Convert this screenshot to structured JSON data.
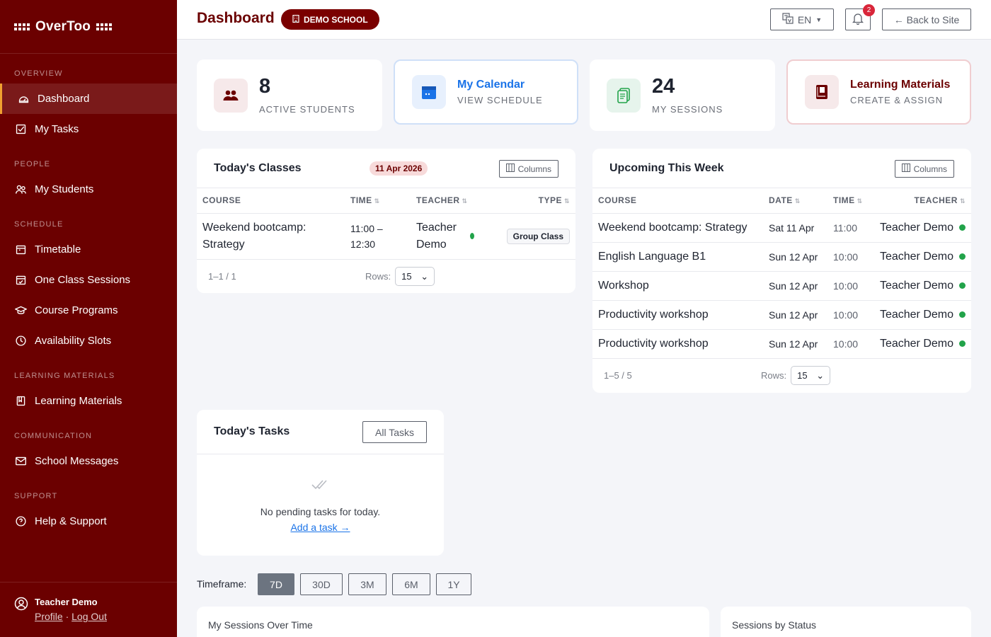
{
  "brand": {
    "name": "OverToo"
  },
  "sidebar": {
    "sections": [
      {
        "label": "OVERVIEW"
      },
      {
        "label": "PEOPLE"
      },
      {
        "label": "SCHEDULE"
      },
      {
        "label": "LEARNING MATERIALS"
      },
      {
        "label": "COMMUNICATION"
      },
      {
        "label": "SUPPORT"
      }
    ],
    "items": [
      {
        "label": "Dashboard",
        "icon": "dashboard-icon",
        "active": true
      },
      {
        "label": "My Tasks",
        "icon": "tasks-icon"
      },
      {
        "label": "My Students",
        "icon": "students-icon"
      },
      {
        "label": "Timetable",
        "icon": "timetable-icon"
      },
      {
        "label": "One Class Sessions",
        "icon": "calendar-check-icon"
      },
      {
        "label": "Course Programs",
        "icon": "graduation-cap-icon"
      },
      {
        "label": "Availability Slots",
        "icon": "clock-icon"
      },
      {
        "label": "Learning Materials",
        "icon": "book-icon"
      },
      {
        "label": "School Messages",
        "icon": "mail-icon"
      },
      {
        "label": "Help & Support",
        "icon": "help-icon"
      }
    ],
    "user": {
      "name": "Teacher Demo",
      "profile_label": "Profile",
      "logout_label": "Log Out"
    }
  },
  "topbar": {
    "title": "Dashboard",
    "school_badge": "DEMO SCHOOL",
    "language": "EN",
    "notification_count": "2",
    "back_label": "← Back to Site"
  },
  "stats": [
    {
      "value": "8",
      "label": "ACTIVE STUDENTS"
    },
    {
      "title": "My Calendar",
      "label": "VIEW SCHEDULE"
    },
    {
      "value": "24",
      "label": "MY SESSIONS"
    },
    {
      "title": "Learning Materials",
      "label": "CREATE & ASSIGN"
    }
  ],
  "todays_classes": {
    "title": "Today's Classes",
    "date": "11 Apr 2026",
    "columns_label": "Columns",
    "headers": [
      "COURSE",
      "TIME",
      "TEACHER",
      "TYPE"
    ],
    "rows": [
      {
        "course": "Weekend bootcamp: Strategy",
        "time": "11:00 – 12:30",
        "teacher": "Teacher Demo",
        "type": "Group Class"
      }
    ],
    "range": "1–1 / 1",
    "rows_label": "Rows:",
    "rows_value": "15"
  },
  "upcoming": {
    "title": "Upcoming This Week",
    "columns_label": "Columns",
    "headers": [
      "COURSE",
      "DATE",
      "TIME",
      "TEACHER"
    ],
    "rows": [
      {
        "course": "Weekend bootcamp: Strategy",
        "date": "Sat 11 Apr",
        "time": "11:00",
        "teacher": "Teacher Demo"
      },
      {
        "course": "English Language B1",
        "date": "Sun 12 Apr",
        "time": "10:00",
        "teacher": "Teacher Demo"
      },
      {
        "course": "Workshop",
        "date": "Sun 12 Apr",
        "time": "10:00",
        "teacher": "Teacher Demo"
      },
      {
        "course": "Productivity workshop",
        "date": "Sun 12 Apr",
        "time": "10:00",
        "teacher": "Teacher Demo"
      },
      {
        "course": "Productivity workshop",
        "date": "Sun 12 Apr",
        "time": "10:00",
        "teacher": "Teacher Demo"
      }
    ],
    "range": "1–5 / 5",
    "rows_label": "Rows:",
    "rows_value": "15"
  },
  "tasks": {
    "title": "Today's Tasks",
    "all_label": "All Tasks",
    "empty_text": "No pending tasks for today.",
    "add_label": "Add a task →"
  },
  "timeframe": {
    "label": "Timeframe:",
    "options": [
      "7D",
      "30D",
      "3M",
      "6M",
      "1Y"
    ],
    "selected": "7D"
  },
  "charts": {
    "sessions_over_time": "My Sessions Over Time",
    "sessions_by_status": "Sessions by Status"
  },
  "colors": {
    "brand": "#6b0000",
    "accent": "#1a73e8",
    "success": "#22a34a"
  }
}
